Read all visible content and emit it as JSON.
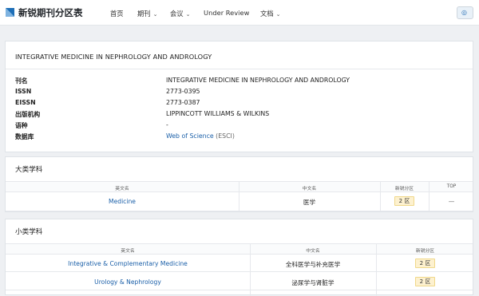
{
  "nav": {
    "brand": "新锐期刊分区表",
    "items": [
      {
        "label": "首页",
        "dropdown": false
      },
      {
        "label": "期刊",
        "dropdown": true
      },
      {
        "label": "会议",
        "dropdown": true
      },
      {
        "label": "Under Review",
        "dropdown": false
      },
      {
        "label": "文档",
        "dropdown": true
      }
    ],
    "chevron": "⌄",
    "settings_icon": "◎",
    "logo_color": "#1e6fb8"
  },
  "journal": {
    "title": "INTEGRATIVE MEDICINE IN NEPHROLOGY AND ANDROLOGY",
    "fields": [
      {
        "label": "刊名",
        "value": "INTEGRATIVE MEDICINE IN NEPHROLOGY AND ANDROLOGY"
      },
      {
        "label": "ISSN",
        "value": "2773-0395"
      },
      {
        "label": "EISSN",
        "value": "2773-0387"
      },
      {
        "label": "出版机构",
        "value": "LIPPINCOTT WILLIAMS & WILKINS"
      },
      {
        "label": "语种",
        "value": "-"
      }
    ],
    "database": {
      "label": "数据库",
      "link": "Web of Science",
      "suffix": " (ESCI)"
    }
  },
  "major": {
    "heading": "大类学科",
    "columns": [
      "英文名",
      "中文名",
      "新锐分区",
      "TOP"
    ],
    "rows": [
      {
        "en": "Medicine",
        "zh": "医学",
        "zone": "2 区",
        "top": "—"
      }
    ]
  },
  "minor": {
    "heading": "小类学科",
    "columns": [
      "英文名",
      "中文名",
      "新锐分区"
    ],
    "rows": [
      {
        "en": "Integrative & Complementary Medicine",
        "zh": "全科医学与补充医学",
        "zone": "2 区"
      },
      {
        "en": "Urology & Nephrology",
        "zh": "泌尿学与肾脏学",
        "zone": "2 区"
      }
    ]
  },
  "colors": {
    "link": "#1a5fa8",
    "badge_bg": "#fdf1cf",
    "badge_border": "#f0d88a"
  }
}
